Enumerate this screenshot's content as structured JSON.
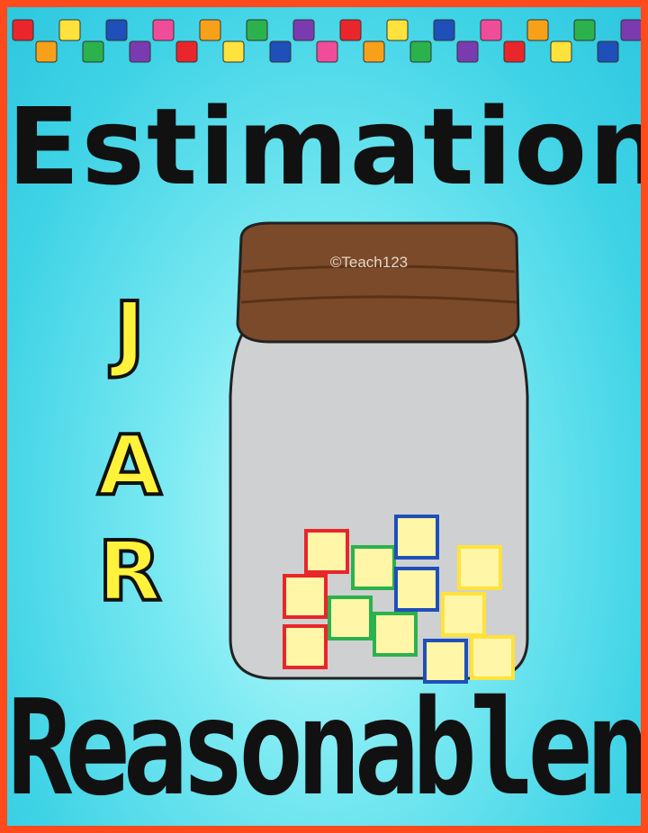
{
  "title": "Estimation",
  "jar_letters": [
    "J",
    "A",
    "R"
  ],
  "subtitle": "Reasonableness",
  "copyright": "©Teach123",
  "colors": {
    "border": "#ff4a1c",
    "background": "#3fd3e6",
    "letter_fill": "#fff23a",
    "lid": "#7a4a2a",
    "jar_glass": "#cfd0d2"
  },
  "top_cube_colors": [
    "#e8262b",
    "#f7a11a",
    "#ffe23b",
    "#2bb24c",
    "#1f4fb8",
    "#7a3bb0",
    "#ef4c9a"
  ],
  "jar_cubes_icon": "unifix-cubes-icon"
}
